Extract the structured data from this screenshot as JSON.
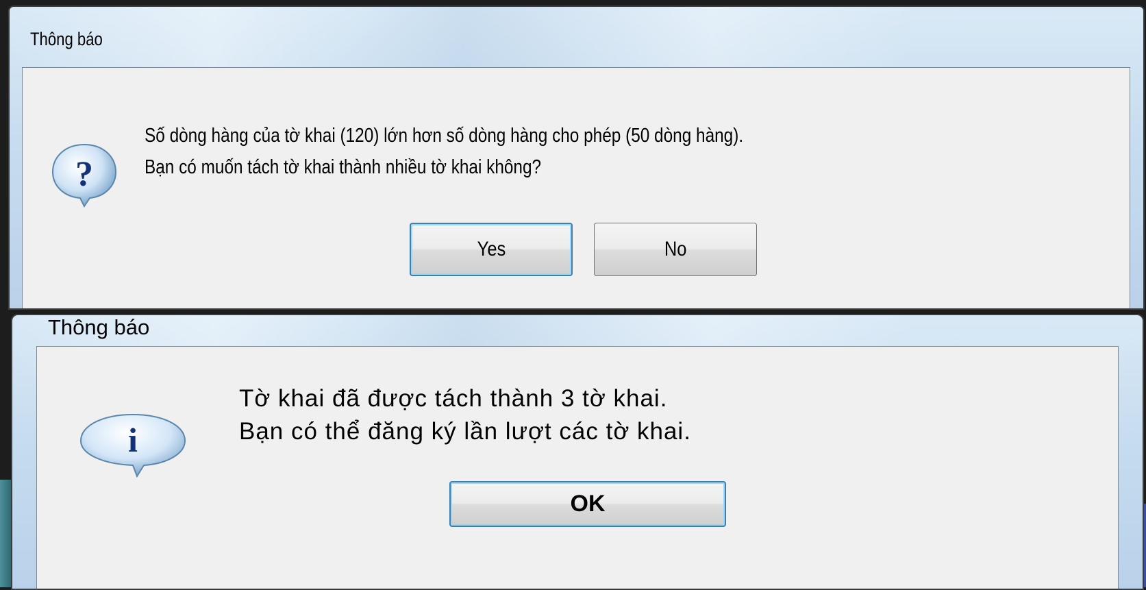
{
  "dialog_split_prompt": {
    "title": "Thông báo",
    "icon": "question-icon",
    "message_line1": "Số dòng hàng của tờ khai (120) lớn hơn số dòng hàng cho phép (50 dòng hàng).",
    "message_line2": "Bạn có muốn tách tờ khai thành nhiều tờ khai không?",
    "yes_label": "Yes",
    "no_label": "No"
  },
  "dialog_split_done": {
    "title": "Thông báo",
    "icon": "info-icon",
    "message_line1": "Tờ khai đã được tách thành 3 tờ khai.",
    "message_line2": "Bạn có thể đăng ký lần lượt các tờ khai.",
    "ok_label": "OK"
  },
  "colors": {
    "title_bar": "#c6dcef",
    "client_area": "#f0f0f0",
    "default_button_border": "#3c7fb1"
  }
}
